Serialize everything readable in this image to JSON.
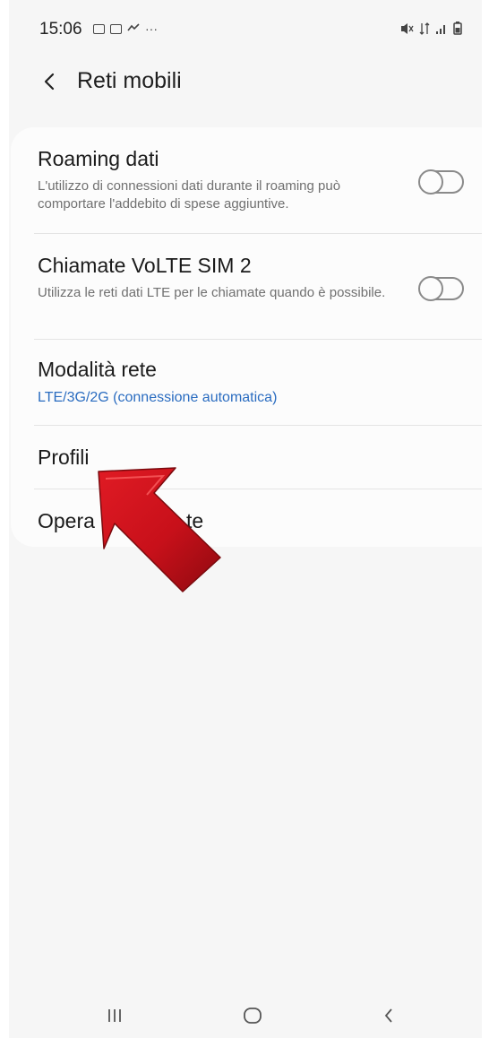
{
  "status_bar": {
    "time": "15:06",
    "left_icons": [
      "gallery-icon",
      "photo-icon",
      "sync-icon",
      "more-notifications-icon"
    ],
    "more_glyph": "···",
    "right_icons": [
      "mute-icon",
      "volte-icon",
      "signal-icon",
      "battery-icon"
    ]
  },
  "header": {
    "title": "Reti mobili"
  },
  "settings": [
    {
      "title": "Roaming dati",
      "description": "L'utilizzo di connessioni dati durante il roaming può comportare l'addebito di spese aggiuntive.",
      "toggle": false
    },
    {
      "title": "Chiamate VoLTE SIM 2",
      "description": "Utilizza le reti dati LTE per le chiamate quando è possibile.",
      "toggle": false
    },
    {
      "title": "Modalità rete",
      "value": "LTE/3G/2G (connessione automatica)"
    },
    {
      "title": "Profili"
    },
    {
      "title_start": "Opera",
      "title_end": "te"
    }
  ],
  "colors": {
    "accent_blue": "#2a6cc0",
    "arrow_red": "#c8101a",
    "background": "#f6f6f6",
    "card": "#fcfcfc"
  },
  "nav": {
    "buttons": [
      "recent-apps-icon",
      "home-icon",
      "back-icon"
    ]
  }
}
